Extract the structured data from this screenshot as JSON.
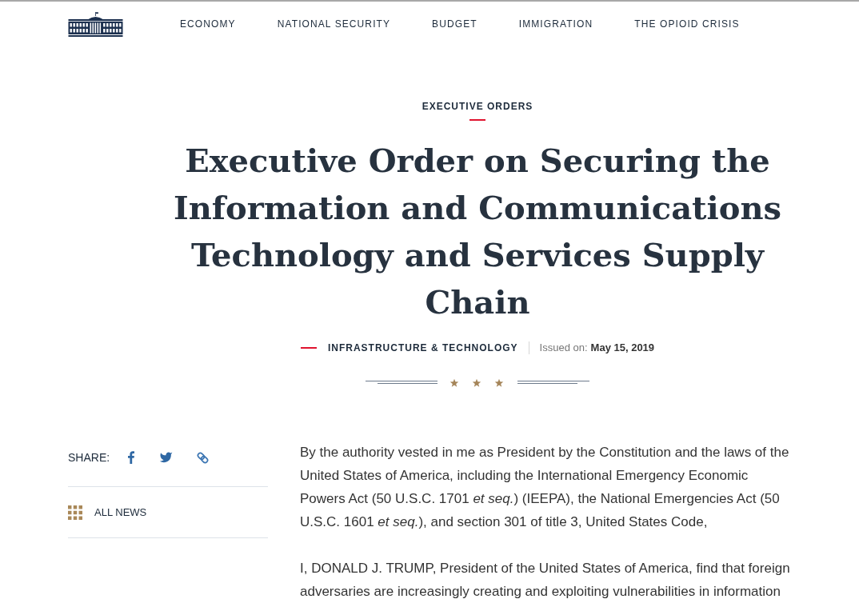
{
  "header": {
    "nav": [
      "ECONOMY",
      "NATIONAL SECURITY",
      "BUDGET",
      "IMMIGRATION",
      "THE OPIOID CRISIS"
    ]
  },
  "article": {
    "category": "EXECUTIVE ORDERS",
    "title": "Executive Order on Securing the Information and Communications Technology and Services Supply Chain",
    "topic": "INFRASTRUCTURE & TECHNOLOGY",
    "issued_label": "Issued on:",
    "issued_date": "May 15, 2019"
  },
  "sidebar": {
    "share_label": "SHARE:",
    "all_news": "ALL NEWS"
  },
  "body": {
    "paragraphs": [
      "By the authority vested in me as President by the Constitution and the laws of the United States of America, including the International Emergency Economic Powers Act (50 U.S.C. 1701 *et seq.*) (IEEPA), the National Emergencies Act (50 U.S.C. 1601 *et seq.*), and section 301 of title 3, United States Code,",
      "I, DONALD J. TRUMP, President of the United States of America, find that foreign adversaries are increasingly creating and exploiting vulnerabilities in information"
    ]
  }
}
